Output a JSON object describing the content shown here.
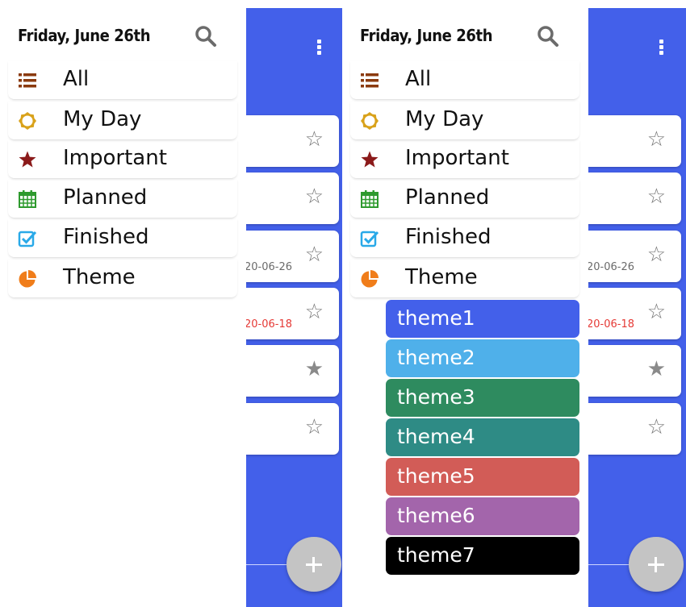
{
  "drawer": {
    "date_header": "Friday, June 26th",
    "items": [
      {
        "label": "All",
        "icon": "list-icon"
      },
      {
        "label": "My Day",
        "icon": "sun-icon"
      },
      {
        "label": "Important",
        "icon": "star-icon"
      },
      {
        "label": "Planned",
        "icon": "calendar-icon"
      },
      {
        "label": "Finished",
        "icon": "checkbox-icon"
      },
      {
        "label": "Theme",
        "icon": "pie-chart-icon"
      }
    ]
  },
  "tasks": [
    {
      "date": "",
      "starred": false
    },
    {
      "date": "",
      "starred": false
    },
    {
      "date": "20-06-26",
      "starred": false,
      "overdue": false
    },
    {
      "date": "20-06-18",
      "starred": false,
      "overdue": true
    },
    {
      "date": "",
      "starred": true
    },
    {
      "date": "",
      "starred": false
    }
  ],
  "themes": [
    {
      "label": "theme1",
      "color": "#4360ea"
    },
    {
      "label": "theme2",
      "color": "#4fb0ea"
    },
    {
      "label": "theme3",
      "color": "#2e8b5f"
    },
    {
      "label": "theme4",
      "color": "#2e8b85"
    },
    {
      "label": "theme5",
      "color": "#d25c57"
    },
    {
      "label": "theme6",
      "color": "#a365ab"
    },
    {
      "label": "theme7",
      "color": "#000000"
    }
  ],
  "colors": {
    "accent": "#4360ea",
    "list_icon": "#8b3a0e",
    "sun_icon": "#d9a21b",
    "star_icon": "#8b1a1a",
    "calendar_icon": "#2e9a2e",
    "checkbox_icon": "#29a9e8",
    "pie_icon": "#f07d1a"
  }
}
